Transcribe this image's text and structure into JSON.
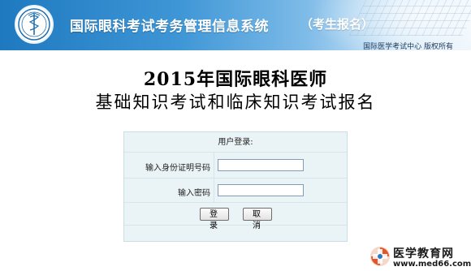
{
  "header": {
    "system_title": "国际眼科考试考务管理信息系统",
    "subtitle": "（考生报名）",
    "copyright": "国际医学考试中心  版权所有",
    "logo_icon": "medical-caduceus-icon"
  },
  "headline": {
    "line1": "2015年国际眼科医师",
    "line2": "基础知识考试和临床知识考试报名"
  },
  "login": {
    "title": "用户登录:",
    "id_label": "输入身份证明号码",
    "id_value": "",
    "password_label": "输入密码",
    "password_value": "",
    "login_button": "登录",
    "cancel_button": "取消"
  },
  "watermark": {
    "name": "医学教育网",
    "url": "www.med66.com",
    "icon": "med66-logo-icon"
  }
}
